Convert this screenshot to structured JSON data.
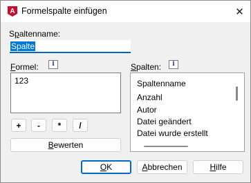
{
  "window": {
    "title": "Formelspalte einfügen",
    "close_glyph": "✕",
    "app_icon": "autocad-a-icon",
    "app_icon_letter": "A",
    "app_icon_color": "#c8102e"
  },
  "column_name": {
    "label": "Spaltenname:",
    "label_hotkey": "p",
    "value": "Spalte"
  },
  "formula": {
    "label": "Formel:",
    "label_hotkey": "F",
    "info_glyph": "i",
    "value": "123"
  },
  "operators": [
    "+",
    "-",
    "*",
    "/"
  ],
  "evaluate_button": {
    "label": "Bewerten",
    "hotkey": "B"
  },
  "columns": {
    "label": "Spalten:",
    "label_hotkey": "S",
    "info_glyph": "i",
    "items": [
      "Spaltenname",
      "Anzahl",
      "Autor",
      "Datei geändert",
      "Datei wurde erstellt"
    ]
  },
  "footer": {
    "ok": {
      "label": "OK",
      "hotkey": "O"
    },
    "cancel": {
      "label": "Abbrechen",
      "hotkey": "A"
    },
    "help": {
      "label": "Hilfe",
      "hotkey": "H"
    }
  },
  "colors": {
    "accent": "#0067c0",
    "selection": "#0078d7",
    "dialog_bg": "#f0f0f0",
    "icon_red": "#c8102e"
  }
}
